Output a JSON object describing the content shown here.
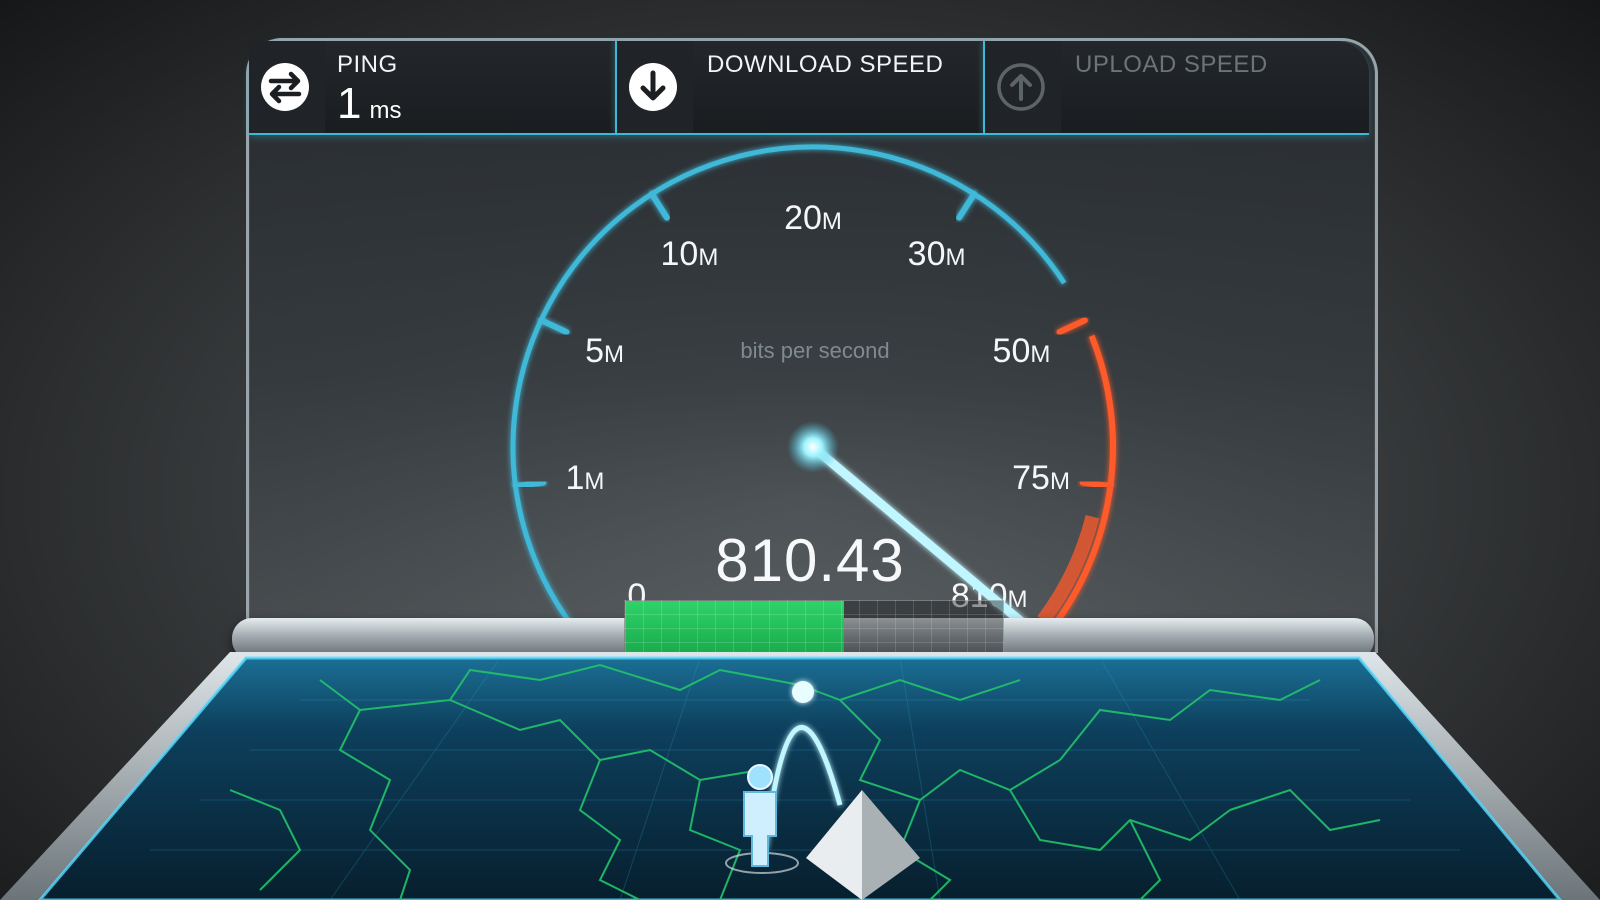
{
  "header": {
    "ping": {
      "label": "PING",
      "value": "1",
      "unit": "ms",
      "icon": "exchange-arrows-icon"
    },
    "download": {
      "label": "DOWNLOAD SPEED",
      "icon": "arrow-down-circle-icon"
    },
    "upload": {
      "label": "UPLOAD SPEED",
      "icon": "arrow-up-circle-icon"
    }
  },
  "gauge": {
    "unit_caption": "bits per second",
    "readout": "810.43",
    "needle_value_mbps": 810.43,
    "ticks": [
      {
        "number": "0",
        "suffix": ""
      },
      {
        "number": "1",
        "suffix": "M"
      },
      {
        "number": "5",
        "suffix": "M"
      },
      {
        "number": "10",
        "suffix": "M"
      },
      {
        "number": "20",
        "suffix": "M"
      },
      {
        "number": "30",
        "suffix": "M"
      },
      {
        "number": "50",
        "suffix": "M"
      },
      {
        "number": "75",
        "suffix": "M"
      },
      {
        "number": "810",
        "suffix": "M"
      }
    ],
    "colors": {
      "low_arc": "#3fb8d8",
      "high_arc": "#ff5a2a",
      "needle": "#bff6ff"
    }
  },
  "progress": {
    "fraction": 0.58,
    "color": "#2fd36a"
  },
  "map": {
    "line_color": "#22c46a",
    "surface_color": "#0d3f5c"
  }
}
